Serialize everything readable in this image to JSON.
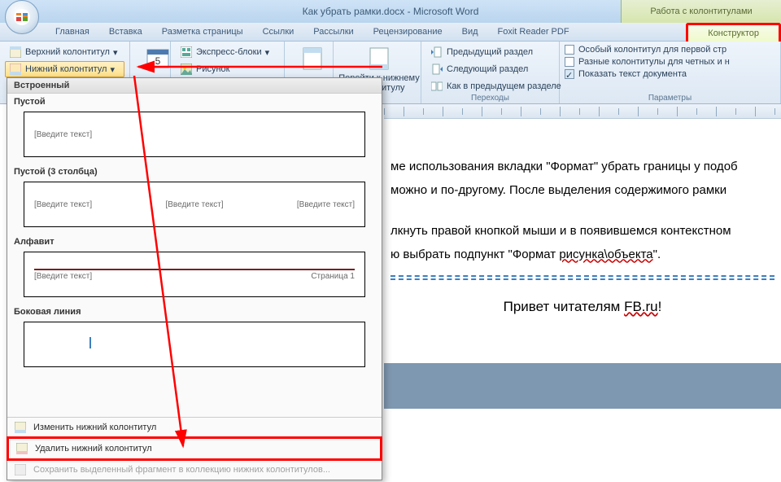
{
  "title": "Как убрать рамки.docx - Microsoft Word",
  "context_title": "Работа с колонтитулами",
  "tabs": [
    "Главная",
    "Вставка",
    "Разметка страницы",
    "Ссылки",
    "Рассылки",
    "Рецензирование",
    "Вид",
    "Foxit Reader PDF"
  ],
  "active_tab": "Конструктор",
  "ribbon": {
    "hf": {
      "top": "Верхний колонтитул",
      "bottom": "Нижний колонтитул"
    },
    "insert": {
      "blocks": "Экспресс-блоки",
      "pic": "Рисунок"
    },
    "goto": {
      "label": "Перейти к нижнему\nколонтитулу"
    },
    "nav": {
      "prev": "Предыдущий раздел",
      "next": "Следующий раздел",
      "same": "Как в предыдущем разделе",
      "group": "Переходы"
    },
    "opts": {
      "first": "Особый колонтитул для первой стр",
      "odd": "Разные колонтитулы для четных и н",
      "show": "Показать текст документа",
      "group": "Параметры"
    }
  },
  "drop": {
    "header": "Встроенный",
    "s1": "Пустой",
    "s1ph": "[Введите текст]",
    "s2": "Пустой (3 столбца)",
    "s2ph": "[Введите текст]",
    "s3": "Алфавит",
    "s3l": "[Введите текст]",
    "s3r": "Страница 1",
    "s4": "Боковая линия",
    "f1": "Изменить нижний колонтитул",
    "f2": "Удалить нижний колонтитул",
    "f3": "Сохранить выделенный фрагмент в коллекцию нижних колонтитулов..."
  },
  "doc": {
    "p1": "ме использования вкладки \"Формат\" убрать границы у подоб",
    "p2": "можно и по-другому. После выделения содержимого рамки",
    "p3": "лкнуть правой кнопкой мыши и в появившемся контекстном",
    "p4a": "ю выбрать подпункт \"Формат ",
    "p4b": "рисунка\\объекта",
    "p4c": "\".",
    "greet_a": "Привет читателям ",
    "greet_b": "FB.ru",
    "greet_c": "!"
  }
}
